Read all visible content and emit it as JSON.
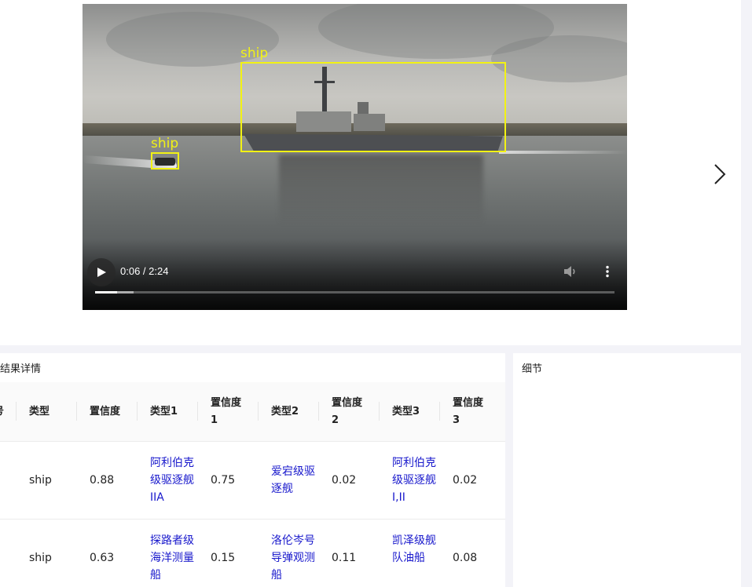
{
  "video": {
    "current_time": "0:06",
    "duration": "2:24",
    "time_display": "0:06 / 2:24",
    "progress_fraction": 0.042,
    "buffered_fraction": 0.074,
    "detections": [
      {
        "label": "ship"
      },
      {
        "label": "ship"
      }
    ],
    "icons": {
      "play": "play-icon",
      "mute": "volume-icon",
      "more": "more-vertical-icon"
    }
  },
  "navigation": {
    "next_icon": "chevron-right-icon"
  },
  "results": {
    "title": "结果详情",
    "columns": [
      "号",
      "类型",
      "置信度",
      "类型1",
      "置信度1",
      "类型2",
      "置信度2",
      "类型3",
      "置信度3"
    ],
    "rows": [
      {
        "type": "ship",
        "confidence": "0.88",
        "type1": "阿利伯克级驱逐舰IIA",
        "conf1": "0.75",
        "type2": "爱宕级驱逐舰",
        "conf2": "0.02",
        "type3": "阿利伯克级驱逐舰I,II",
        "conf3": "0.02"
      },
      {
        "type": "ship",
        "confidence": "0.63",
        "type1": "探路者级海洋测量船",
        "conf1": "0.15",
        "type2": "洛伦岑号导弹观测船",
        "conf2": "0.11",
        "type3": "凯泽级舰队油船",
        "conf3": "0.08"
      }
    ]
  },
  "detail": {
    "title": "细节"
  },
  "colors": {
    "detection_box": "#f2f214",
    "link_text": "#1818cc",
    "page_background": "#f3f3f8"
  }
}
